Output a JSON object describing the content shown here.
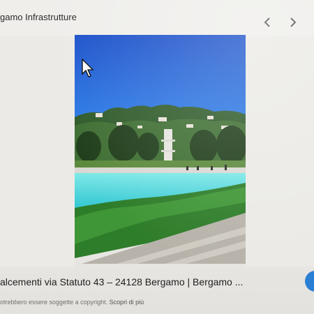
{
  "header": {
    "title": "gamo Infrastrutture",
    "prev_icon": "chevron-left-icon",
    "next_icon": "chevron-right-icon"
  },
  "image": {
    "subject": "outdoor swimming pool"
  },
  "caption": {
    "text": "alcementi via Statuto 43 – 24128 Bergamo | Bergamo ..."
  },
  "copyright": {
    "text": "otrebbero essere soggette a copyright.",
    "link": "Scopri di più"
  },
  "colors": {
    "accent_blue": "#2a7fd4",
    "pool_water": "#3fd2d8",
    "sky": "#1d5fd6"
  }
}
